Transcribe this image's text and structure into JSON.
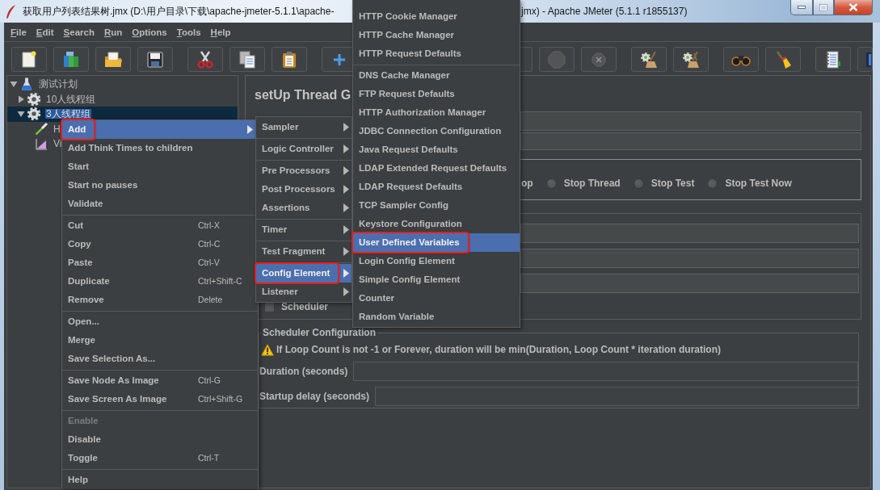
{
  "window": {
    "title_parts": [
      "获取用户列表结果树.jmx (D:\\用户目录\\下载\\apache-jmeter-5.1.1\\apache-",
      "jmx) - Apache JMeter (5.1.1 r1855137)"
    ]
  },
  "menu_bar": [
    "File",
    "Edit",
    "Search",
    "Run",
    "Options",
    "Tools",
    "Help"
  ],
  "toolbar": [
    [
      {
        "kind": "new",
        "disabled": false
      },
      {
        "kind": "templates",
        "disabled": false
      },
      {
        "kind": "open",
        "disabled": false
      },
      {
        "kind": "save",
        "disabled": false
      }
    ],
    [
      {
        "kind": "cut",
        "disabled": false
      },
      {
        "kind": "copy",
        "disabled": false
      },
      {
        "kind": "paste",
        "disabled": false
      }
    ],
    [
      {
        "kind": "expand",
        "disabled": false
      }
    ],
    [
      {
        "kind": "stop",
        "disabled": true
      },
      {
        "kind": "shutdown",
        "disabled": true
      }
    ],
    [
      {
        "kind": "clear",
        "disabled": false
      },
      {
        "kind": "clearall",
        "disabled": false
      }
    ],
    [
      {
        "kind": "search",
        "disabled": false
      },
      {
        "kind": "reset",
        "disabled": false
      }
    ],
    [
      {
        "kind": "functions",
        "disabled": false
      },
      {
        "kind": "help",
        "disabled": false
      }
    ]
  ],
  "tree": [
    {
      "label": "测试计划",
      "kind": "plan",
      "expanded": true,
      "selected": false,
      "children": [
        {
          "label": "10人线程组",
          "kind": "group",
          "expanded": false,
          "selected": false
        },
        {
          "label": "3人线程组",
          "kind": "group",
          "expanded": true,
          "selected": true,
          "children": [
            {
              "label": "H",
              "kind": "sampler",
              "selected": false
            },
            {
              "label": "Vi",
              "kind": "listener",
              "selected": false
            }
          ]
        }
      ]
    }
  ],
  "panel": {
    "title": "setUp Thread G",
    "error_action": {
      "fragment": "op",
      "options": [
        {
          "label": "Stop Thread",
          "selected": false
        },
        {
          "label": "Stop Test",
          "selected": false
        },
        {
          "label": "Stop Test Now",
          "selected": false
        }
      ]
    },
    "scheduler_checkbox": {
      "label": "Scheduler",
      "checked": false
    },
    "scheduler": {
      "title": "Scheduler Configuration",
      "warning": "If Loop Count is not -1 or Forever, duration will be min(Duration, Loop Count * iteration duration)",
      "fields": [
        {
          "label": "Duration (seconds)"
        },
        {
          "label": "Startup delay (seconds)"
        }
      ]
    }
  },
  "context_menu": {
    "sections": [
      [
        {
          "label": "Add",
          "selected": true,
          "disabled": false,
          "submenu": true,
          "outlined": true
        },
        {
          "label": "Add Think Times to children",
          "selected": false,
          "disabled": false,
          "submenu": false,
          "outlined": false
        },
        {
          "label": "Start",
          "selected": false,
          "disabled": false,
          "submenu": false,
          "outlined": false
        },
        {
          "label": "Start no pauses",
          "selected": false,
          "disabled": false,
          "submenu": false,
          "outlined": false
        },
        {
          "label": "Validate",
          "selected": false,
          "disabled": false,
          "submenu": false,
          "outlined": false
        }
      ],
      [
        {
          "label": "Cut",
          "shortcut": "Ctrl-X",
          "selected": false,
          "disabled": false,
          "submenu": false,
          "outlined": false
        },
        {
          "label": "Copy",
          "shortcut": "Ctrl-C",
          "selected": false,
          "disabled": false,
          "submenu": false,
          "outlined": false
        },
        {
          "label": "Paste",
          "shortcut": "Ctrl-V",
          "selected": false,
          "disabled": false,
          "submenu": false,
          "outlined": false
        },
        {
          "label": "Duplicate",
          "shortcut": "Ctrl+Shift-C",
          "selected": false,
          "disabled": false,
          "submenu": false,
          "outlined": false
        },
        {
          "label": "Remove",
          "shortcut": "Delete",
          "selected": false,
          "disabled": false,
          "submenu": false,
          "outlined": false
        }
      ],
      [
        {
          "label": "Open...",
          "selected": false,
          "disabled": false,
          "submenu": false,
          "outlined": false
        },
        {
          "label": "Merge",
          "selected": false,
          "disabled": false,
          "submenu": false,
          "outlined": false
        },
        {
          "label": "Save Selection As...",
          "selected": false,
          "disabled": false,
          "submenu": false,
          "outlined": false
        }
      ],
      [
        {
          "label": "Save Node As Image",
          "shortcut": "Ctrl-G",
          "selected": false,
          "disabled": false,
          "submenu": false,
          "outlined": false
        },
        {
          "label": "Save Screen As Image",
          "shortcut": "Ctrl+Shift-G",
          "selected": false,
          "disabled": false,
          "submenu": false,
          "outlined": false
        }
      ],
      [
        {
          "label": "Enable",
          "selected": false,
          "disabled": true,
          "submenu": false,
          "outlined": false
        },
        {
          "label": "Disable",
          "selected": false,
          "disabled": false,
          "submenu": false,
          "outlined": false
        },
        {
          "label": "Toggle",
          "shortcut": "Ctrl-T",
          "selected": false,
          "disabled": false,
          "submenu": false,
          "outlined": false
        }
      ],
      [
        {
          "label": "Help",
          "selected": false,
          "disabled": false,
          "submenu": false,
          "outlined": false
        }
      ]
    ]
  },
  "add_submenu": {
    "sections": [
      [
        {
          "label": "Sampler",
          "selected": false,
          "submenu": true,
          "outlined": false
        }
      ],
      [
        {
          "label": "Logic Controller",
          "selected": false,
          "submenu": true,
          "outlined": false
        }
      ],
      [
        {
          "label": "Pre Processors",
          "selected": false,
          "submenu": true,
          "outlined": false
        },
        {
          "label": "Post Processors",
          "selected": false,
          "submenu": true,
          "outlined": false
        },
        {
          "label": "Assertions",
          "selected": false,
          "submenu": true,
          "outlined": false
        }
      ],
      [
        {
          "label": "Timer",
          "selected": false,
          "submenu": true,
          "outlined": false
        }
      ],
      [
        {
          "label": "Test Fragment",
          "selected": false,
          "submenu": true,
          "outlined": false
        }
      ],
      [
        {
          "label": "Config Element",
          "selected": true,
          "submenu": true,
          "outlined": true
        },
        {
          "label": "Listener",
          "selected": false,
          "submenu": true,
          "outlined": false
        }
      ]
    ]
  },
  "config_submenu": {
    "sections": [
      [
        {
          "label": "HTTP Cookie Manager",
          "selected": false,
          "outlined": false
        },
        {
          "label": "HTTP Cache Manager",
          "selected": false,
          "outlined": false
        },
        {
          "label": "HTTP Request Defaults",
          "selected": false,
          "outlined": false
        }
      ],
      [
        {
          "label": "DNS Cache Manager",
          "selected": false,
          "outlined": false
        },
        {
          "label": "FTP Request Defaults",
          "selected": false,
          "outlined": false
        },
        {
          "label": "HTTP Authorization Manager",
          "selected": false,
          "outlined": false
        },
        {
          "label": "JDBC Connection Configuration",
          "selected": false,
          "outlined": false
        },
        {
          "label": "Java Request Defaults",
          "selected": false,
          "outlined": false
        },
        {
          "label": "LDAP Extended Request Defaults",
          "selected": false,
          "outlined": false
        },
        {
          "label": "LDAP Request Defaults",
          "selected": false,
          "outlined": false
        },
        {
          "label": "TCP Sampler Config",
          "selected": false,
          "outlined": false
        },
        {
          "label": "Keystore Configuration",
          "selected": false,
          "outlined": false
        },
        {
          "label": "User Defined Variables",
          "selected": true,
          "outlined": true
        },
        {
          "label": "Login Config Element",
          "selected": false,
          "outlined": false
        },
        {
          "label": "Simple Config Element",
          "selected": false,
          "outlined": false
        },
        {
          "label": "Counter",
          "selected": false,
          "outlined": false
        },
        {
          "label": "Random Variable",
          "selected": false,
          "outlined": false
        }
      ]
    ]
  }
}
